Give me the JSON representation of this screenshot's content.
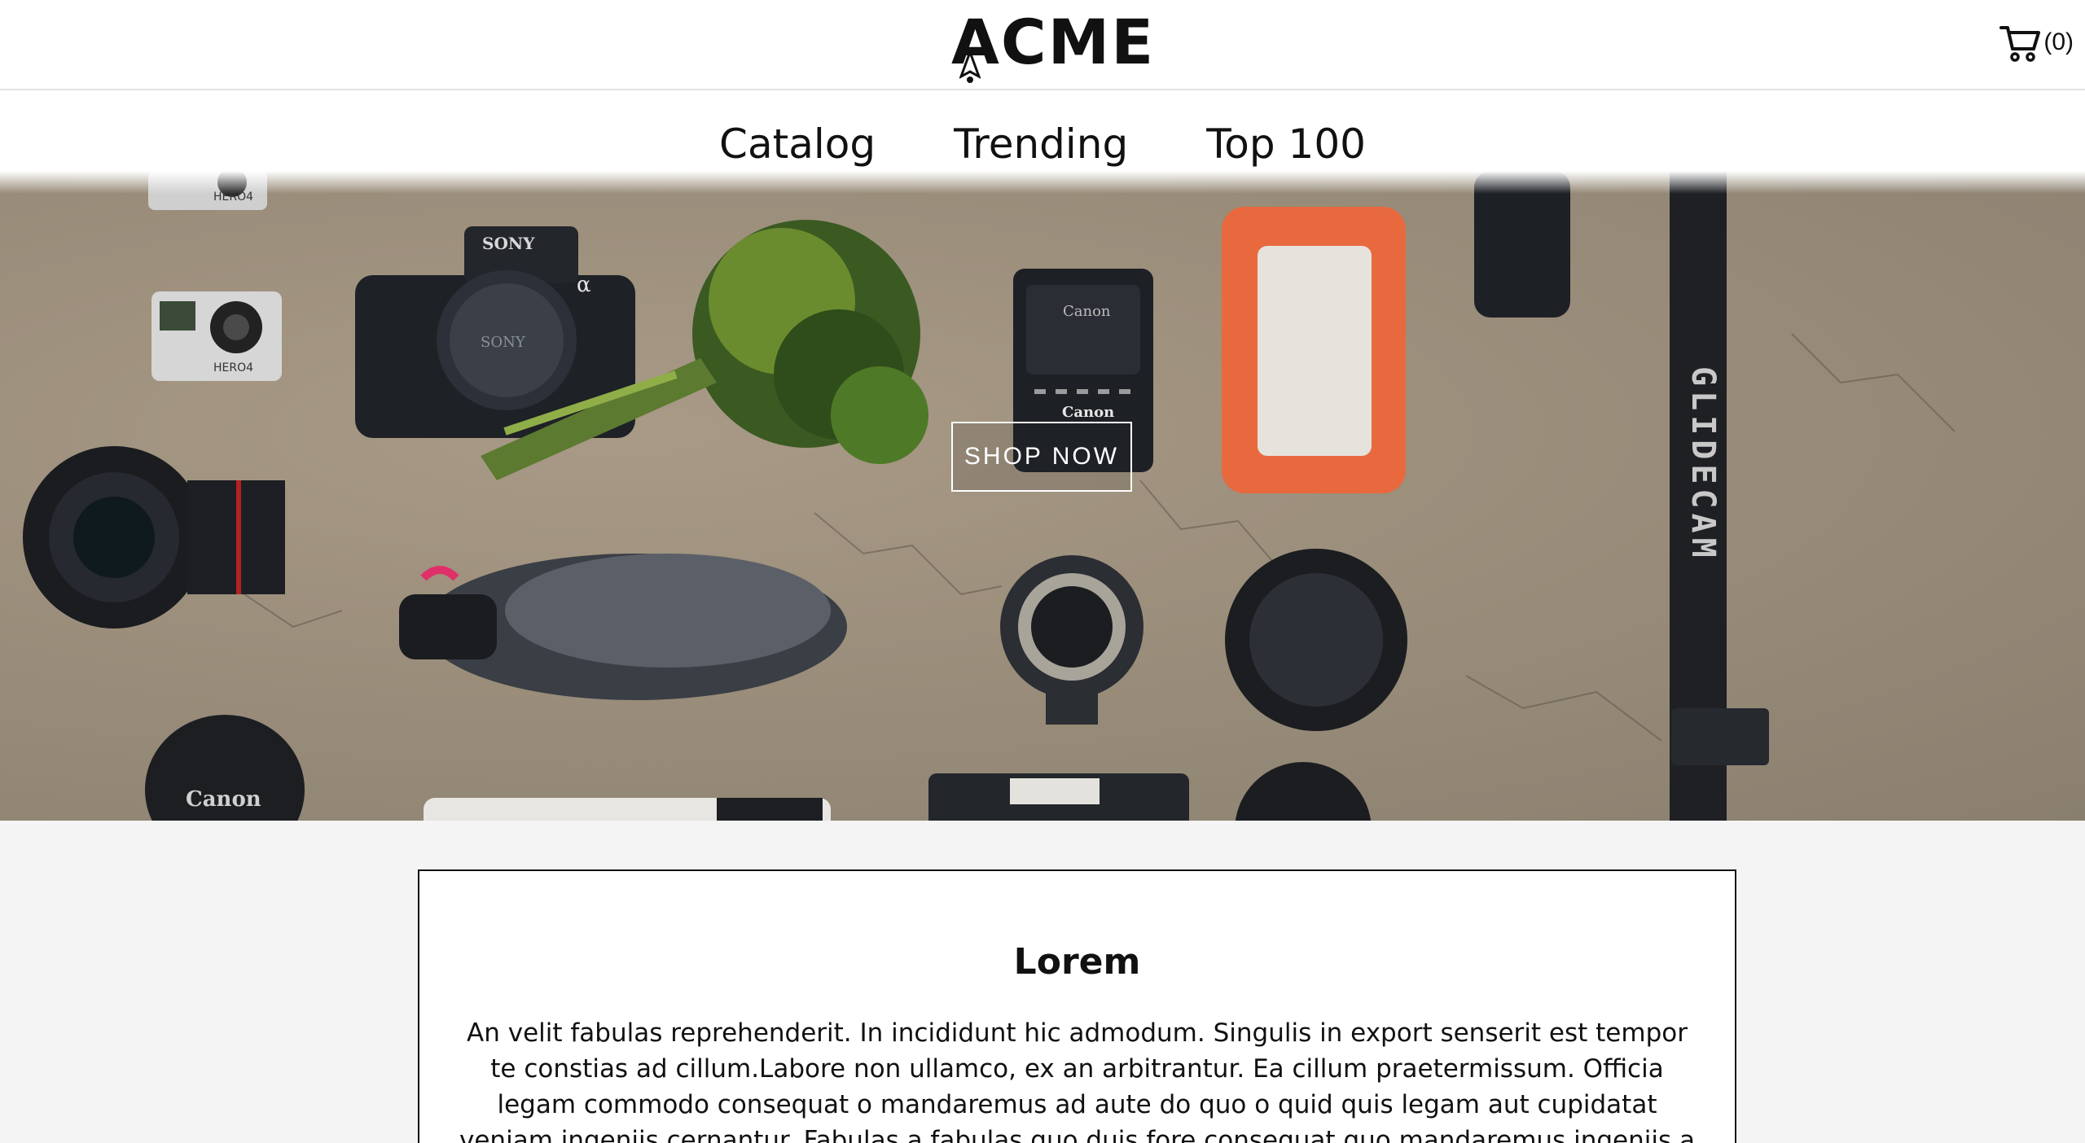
{
  "header": {
    "logo_text": "ACME",
    "cart_count": "(0)"
  },
  "nav": {
    "items": [
      "Catalog",
      "Trending",
      "Top 100"
    ]
  },
  "hero": {
    "cta_label": "SHOP NOW",
    "product_text": {
      "gopro_top": "HERO4",
      "gopro_bottom": "HERO4",
      "sony_brand": "SONY",
      "sony_mount": "SONY",
      "alpha": "α",
      "charger_top": "Canon",
      "charger_bottom": "Canon",
      "lens_cap": "Canon",
      "glidecam": "GLIDECAM"
    }
  },
  "article": {
    "title": "Lorem",
    "body": "An velit fabulas reprehenderit. In incididunt hic admodum. Singulis in export senserit est tempor te constias ad cillum.Labore non ullamco, ex an arbitrantur. Ea cillum praetermissum. Officia legam commodo consequat o mandaremus ad aute do quo o quid quis legam aut cupidatat veniam ingeniis cernantur. Fabulas a fabulas quo duis fore consequat quo mandaremus ingeniis a quorum te familiaritatem cortum non quem nostrud cupidatat"
  }
}
